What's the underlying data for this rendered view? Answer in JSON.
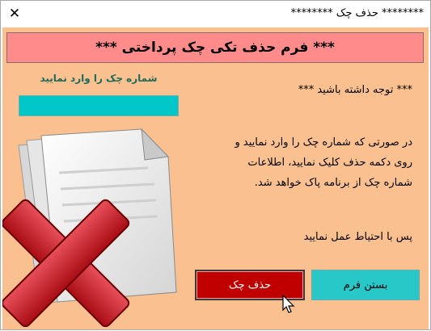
{
  "window": {
    "title": "******** حذف چک ********",
    "close_glyph": "✕"
  },
  "form": {
    "header": "*** فرم حذف تکی چک پرداختی ***",
    "field_label": "شماره چک را وارد نمایید",
    "input_value": "",
    "note_title": "*** توجه داشته باشید ***",
    "description_lines": [
      "در صورتی که شماره چک را وارد نمایید و",
      "روی دکمه حذف کلیک نمایید، اطلاعات",
      "شماره چک از برنامه پاک خواهد شد."
    ],
    "caution": "پس با احتیاط عمل نمایید",
    "delete_button": "حذف چک",
    "close_button": "بستن فرم"
  },
  "icons": {
    "art": "deleted-document-icon",
    "cursor": "mouse-cursor-icon"
  },
  "colors": {
    "background": "#fac090",
    "header": "#ff8b8b",
    "input": "#00c8c8",
    "delete_button": "#c00000",
    "close_button": "#28c8c8"
  }
}
